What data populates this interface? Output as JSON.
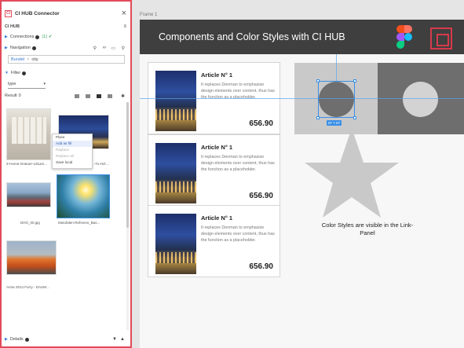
{
  "panel": {
    "title": "CI HUB Connector",
    "logo_text": "CI",
    "section_label": "CI HUB",
    "connections_label": "Connections",
    "connections_status": "(1) ✔",
    "navigation_label": "Navigation",
    "bundle_chip": "Bundel",
    "search_value": "city",
    "filter_label": "Filter",
    "filter_select": "type",
    "result_label": "Result",
    "result_count": "0",
    "details_label": "Details",
    "thumbnails": [
      {
        "caption": "Z-Home-Gratuer-1d1am..."
      },
      {
        "caption": "...-Tu-Hd-..."
      },
      {
        "caption": "DHO_00.jpg"
      },
      {
        "caption": "Motofalen-Rehnens_Bas..."
      },
      {
        "caption": "Arras 2014 Furry - DAUM..."
      }
    ],
    "badges": {
      "small": "JPG"
    },
    "context_menu": {
      "items": [
        "Place",
        "Add as fill",
        "Replace",
        "Replace all",
        "Save local"
      ]
    }
  },
  "canvas": {
    "frame_label": "Frame 1",
    "header_title": "Components and Color Styles with CI HUB",
    "cards": [
      {
        "title": "Article N° 1",
        "description": "It replaces Denman to emphasize design elements over content, thus has the function as a placeholder.",
        "price": "656.90"
      },
      {
        "title": "Article N° 1",
        "description": "It replaces Denman to emphasize design elements over content, thus has the function as a placeholder.",
        "price": "656.90"
      },
      {
        "title": "Article N° 1",
        "description": "It replaces Denman to emphasize design elements over content, thus has the function as a placeholder.",
        "price": "656.90"
      }
    ],
    "selection_dims": "67 × 67",
    "color_styles_text": "Color Styles are visible in the Link-Panel"
  },
  "colors": {
    "header_bg": "#3f3f3f",
    "accent_red": "#e24a5a",
    "selection_blue": "#3a8fe6",
    "shape_dark": "#6e6e6e",
    "shape_light": "#d3d3d3"
  }
}
